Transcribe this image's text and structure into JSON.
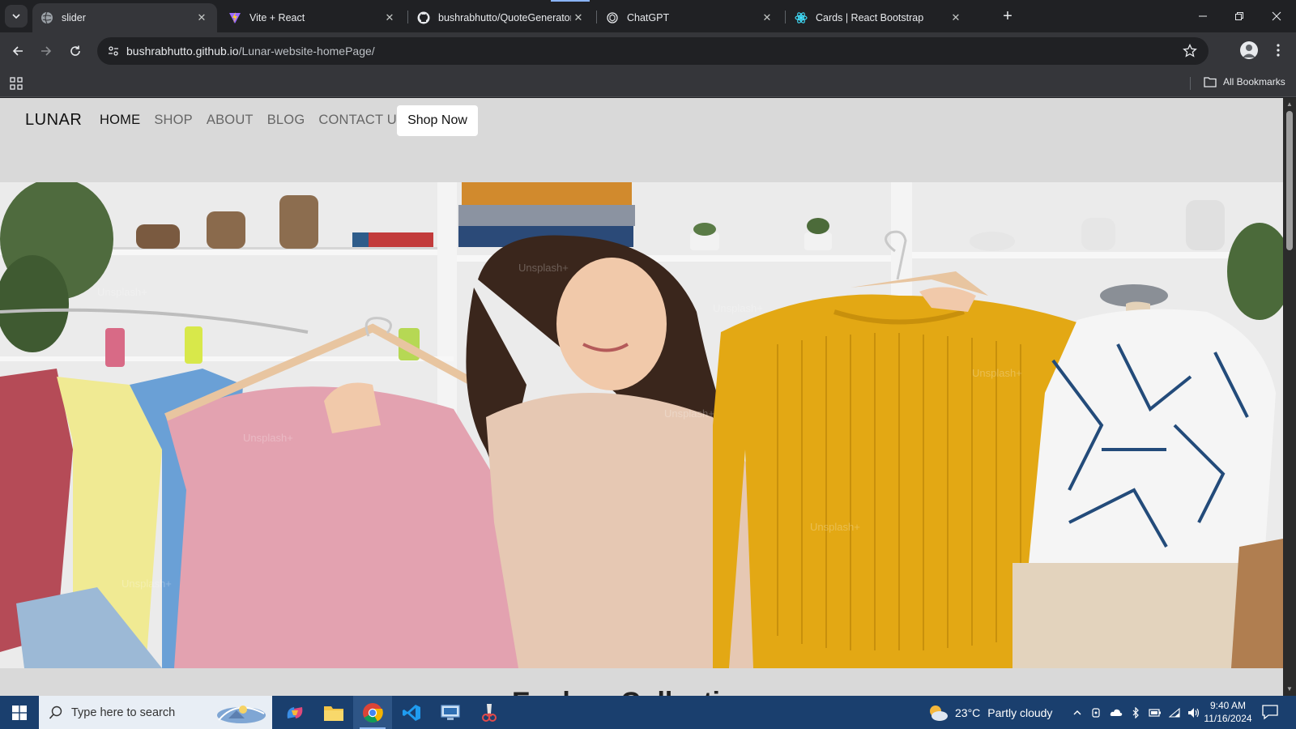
{
  "browser": {
    "tabs": [
      {
        "title": "slider",
        "active": true,
        "icon": "globe-icon"
      },
      {
        "title": "Vite + React",
        "active": false,
        "icon": "vite-icon"
      },
      {
        "title": "bushrabhutto/QuoteGenerator",
        "active": false,
        "icon": "github-icon"
      },
      {
        "title": "ChatGPT",
        "active": false,
        "icon": "chatgpt-icon"
      },
      {
        "title": "Cards | React Bootstrap",
        "active": false,
        "icon": "bootstrap-icon"
      }
    ],
    "url_host": "bushrabhutto.github.io",
    "url_path": "/Lunar-website-homePage/",
    "bookmarks_label": "All Bookmarks"
  },
  "site": {
    "brand": "LUNAR",
    "nav": [
      "HOME",
      "SHOP",
      "ABOUT",
      "BLOG",
      "CONTACT US"
    ],
    "cta": "Shop Now",
    "section_title": "Explore Collection",
    "colors": {
      "nav_bg": "#d9d9d9",
      "cta_bg": "#ffffff",
      "active_link": "#111111",
      "link": "#666666"
    }
  },
  "taskbar": {
    "search_placeholder": "Type here to search",
    "weather_temp": "23°C",
    "weather_desc": "Partly cloudy",
    "time": "9:40 AM",
    "date": "11/16/2024"
  }
}
